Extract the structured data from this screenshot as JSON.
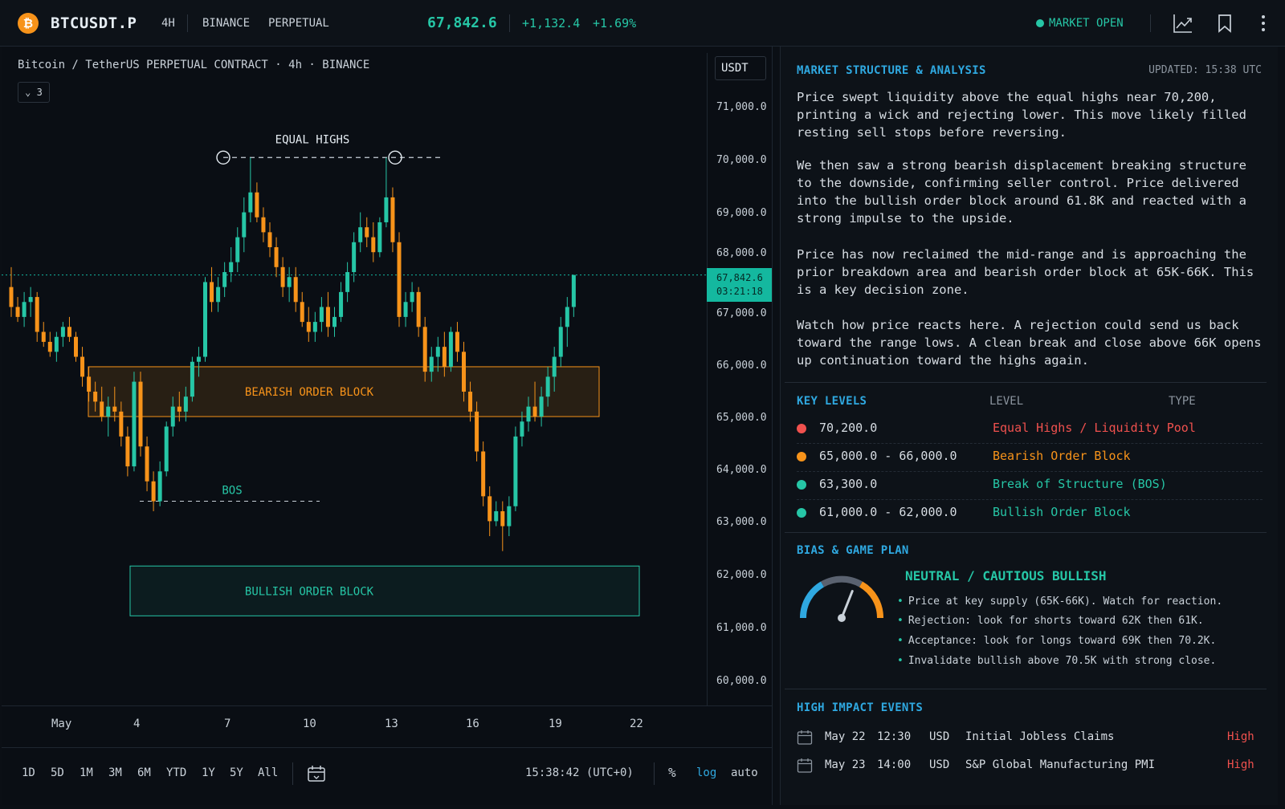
{
  "header": {
    "logo_glyph": "₿",
    "symbol": "BTCUSDT.P",
    "timeframe": "4H",
    "exchange": "BINANCE",
    "contract": "PERPETUAL",
    "price": "67,842.6",
    "change": "+1,132.4",
    "change_pct": "+1.69%",
    "market_status": "MARKET OPEN",
    "icons": [
      "chart-icon",
      "bookmark-icon",
      "more-icon"
    ]
  },
  "chart": {
    "title": "Bitcoin / TetherUS PERPETUAL CONTRACT · 4h · BINANCE",
    "indicator_toggle": "⌄ 3",
    "unit": "USDT",
    "y_ticks": [
      "71,000.0",
      "70,000.0",
      "69,000.0",
      "68,000.0",
      "67,000.0",
      "66,000.0",
      "65,000.0",
      "64,000.0",
      "63,000.0",
      "62,000.0",
      "61,000.0",
      "60,000.0"
    ],
    "price_tag": "67,842.6",
    "countdown": "03:21:18",
    "x_ticks": [
      "May",
      "4",
      "7",
      "10",
      "13",
      "16",
      "19",
      "22"
    ],
    "annotations": {
      "equal_highs": "EQUAL HIGHS",
      "bearish_ob": "BEARISH ORDER BLOCK",
      "bullish_ob": "BULLISH ORDER BLOCK",
      "bos": "BOS"
    },
    "ranges": [
      "1D",
      "5D",
      "1M",
      "3M",
      "6M",
      "YTD",
      "1Y",
      "5Y",
      "All"
    ],
    "clock": "15:38:42 (UTC+0)",
    "pct": "%",
    "log": "log",
    "auto": "auto",
    "colors": {
      "up": "#26c6a6",
      "down": "#f7931a",
      "bear_zone": "#f7931a",
      "bull_zone": "#26c6a6"
    }
  },
  "chart_data": {
    "type": "candlestick",
    "title": "Bitcoin / TetherUS PERPETUAL CONTRACT · 4h · BINANCE",
    "ylabel": "USDT",
    "ylim": [
      59700,
      71300
    ],
    "x_ticks": [
      "May",
      "4",
      "7",
      "10",
      "13",
      "16",
      "19",
      "22"
    ],
    "last_price": 67842.6,
    "levels": {
      "equal_highs": 70200,
      "bearish_order_block": [
        65000,
        66000
      ],
      "bos": 63300,
      "bullish_order_block": [
        61000,
        62000
      ]
    },
    "ohlc": [
      [
        67600,
        68000,
        67000,
        67200
      ],
      [
        67200,
        67400,
        66900,
        67000
      ],
      [
        67000,
        67500,
        66800,
        67300
      ],
      [
        67300,
        67600,
        67000,
        67400
      ],
      [
        67400,
        67500,
        66500,
        66700
      ],
      [
        66700,
        66900,
        66400,
        66500
      ],
      [
        66500,
        66700,
        66200,
        66300
      ],
      [
        66300,
        66700,
        66100,
        66600
      ],
      [
        66600,
        66900,
        66400,
        66800
      ],
      [
        66800,
        67000,
        66500,
        66600
      ],
      [
        66600,
        66700,
        66100,
        66200
      ],
      [
        66200,
        66400,
        65600,
        65800
      ],
      [
        65800,
        66000,
        65300,
        65500
      ],
      [
        65500,
        65700,
        65100,
        65300
      ],
      [
        65300,
        65600,
        64900,
        65000
      ],
      [
        65000,
        65400,
        64600,
        65200
      ],
      [
        65200,
        65600,
        64900,
        65100
      ],
      [
        65100,
        65300,
        64400,
        64600
      ],
      [
        64600,
        64800,
        63800,
        64000
      ],
      [
        64000,
        65900,
        63900,
        65700
      ],
      [
        65700,
        65900,
        64200,
        64400
      ],
      [
        64400,
        64600,
        63500,
        63700
      ],
      [
        63700,
        63900,
        63100,
        63300
      ],
      [
        63300,
        64100,
        63200,
        63900
      ],
      [
        63900,
        64900,
        63800,
        64800
      ],
      [
        64800,
        65400,
        64600,
        65200
      ],
      [
        65200,
        65500,
        64900,
        65100
      ],
      [
        65100,
        65600,
        64900,
        65400
      ],
      [
        65400,
        66200,
        65300,
        66100
      ],
      [
        66100,
        66400,
        65800,
        66200
      ],
      [
        66200,
        67800,
        66100,
        67700
      ],
      [
        67700,
        68000,
        67100,
        67300
      ],
      [
        67300,
        67800,
        67100,
        67600
      ],
      [
        67600,
        68100,
        67400,
        67900
      ],
      [
        67900,
        68400,
        67700,
        68100
      ],
      [
        68100,
        68800,
        67900,
        68600
      ],
      [
        68600,
        69400,
        68300,
        69100
      ],
      [
        69100,
        70200,
        68900,
        69500
      ],
      [
        69500,
        69700,
        68900,
        69000
      ],
      [
        69000,
        69200,
        68500,
        68700
      ],
      [
        68700,
        68900,
        68200,
        68400
      ],
      [
        68400,
        68600,
        67800,
        68000
      ],
      [
        68000,
        68200,
        67400,
        67600
      ],
      [
        67600,
        68000,
        67300,
        67800
      ],
      [
        67800,
        68000,
        67100,
        67300
      ],
      [
        67300,
        67500,
        66800,
        66900
      ],
      [
        66900,
        67200,
        66500,
        66700
      ],
      [
        66700,
        67100,
        66500,
        66900
      ],
      [
        66900,
        67400,
        66700,
        67200
      ],
      [
        67200,
        67500,
        66600,
        66800
      ],
      [
        66800,
        67200,
        66600,
        67000
      ],
      [
        67000,
        67700,
        66900,
        67500
      ],
      [
        67500,
        68100,
        67300,
        67900
      ],
      [
        67900,
        68700,
        67700,
        68500
      ],
      [
        68500,
        69100,
        68300,
        68800
      ],
      [
        68800,
        69000,
        68400,
        68600
      ],
      [
        68600,
        68900,
        68100,
        68300
      ],
      [
        68300,
        69000,
        68200,
        68900
      ],
      [
        68900,
        70200,
        68800,
        69400
      ],
      [
        69400,
        69600,
        68300,
        68500
      ],
      [
        68500,
        68700,
        66800,
        67000
      ],
      [
        67000,
        67500,
        66800,
        67300
      ],
      [
        67300,
        67700,
        67100,
        67500
      ],
      [
        67500,
        67600,
        66600,
        66800
      ],
      [
        66800,
        67000,
        65700,
        65900
      ],
      [
        65900,
        66400,
        65700,
        66200
      ],
      [
        66200,
        66600,
        65900,
        66400
      ],
      [
        66400,
        66700,
        65800,
        66000
      ],
      [
        66000,
        66800,
        65900,
        66700
      ],
      [
        66700,
        66900,
        66100,
        66300
      ],
      [
        66300,
        66500,
        65300,
        65500
      ],
      [
        65500,
        65700,
        64900,
        65100
      ],
      [
        65100,
        65300,
        64100,
        64300
      ],
      [
        64300,
        64500,
        63200,
        63400
      ],
      [
        63400,
        63600,
        62600,
        62900
      ],
      [
        62900,
        63300,
        62800,
        63100
      ],
      [
        63100,
        63300,
        62300,
        62800
      ],
      [
        62800,
        63400,
        62600,
        63200
      ],
      [
        63200,
        64800,
        63100,
        64600
      ],
      [
        64600,
        65100,
        64400,
        64900
      ],
      [
        64900,
        65400,
        64700,
        65200
      ],
      [
        65200,
        65700,
        64900,
        65000
      ],
      [
        65000,
        65600,
        64800,
        65400
      ],
      [
        65400,
        66000,
        65200,
        65800
      ],
      [
        65800,
        66400,
        65500,
        66200
      ],
      [
        66200,
        67000,
        66000,
        66800
      ],
      [
        66800,
        67400,
        66400,
        67200
      ],
      [
        67200,
        67842.6,
        67000,
        67842.6
      ]
    ]
  },
  "panel": {
    "analysis": {
      "heading": "MARKET STRUCTURE & ANALYSIS",
      "updated": "UPDATED: 15:38 UTC",
      "p1": "Price swept liquidity above the equal highs near 70,200, printing a wick and rejecting lower. This move likely filled resting sell stops before reversing.",
      "p2": "We then saw a strong bearish displacement breaking structure to the downside, confirming seller control. Price delivered into the bullish order block around 61.8K and reacted with a strong impulse to the upside.",
      "p3": "Price has now reclaimed the mid-range and is approaching the prior breakdown area and bearish order block at 65K-66K. This is a key decision zone.",
      "p4": "Watch how price reacts here. A rejection could send us back toward the range lows. A clean break and close above 66K opens up continuation toward the highs again."
    },
    "key_levels": {
      "heading": "KEY LEVELS",
      "col_level": "LEVEL",
      "col_type": "TYPE",
      "rows": [
        {
          "level": "70,200.0",
          "type": "Equal Highs / Liquidity Pool",
          "color": "#f0514e"
        },
        {
          "level": "65,000.0 - 66,000.0",
          "type": "Bearish Order Block",
          "color": "#f7931a"
        },
        {
          "level": "63,300.0",
          "type": "Break of Structure (BOS)",
          "color": "#26c6a6"
        },
        {
          "level": "61,000.0 - 62,000.0",
          "type": "Bullish Order Block",
          "color": "#26c6a6"
        }
      ]
    },
    "bias": {
      "heading": "BIAS & GAME PLAN",
      "title": "NEUTRAL / CAUTIOUS BULLISH",
      "gauge_level": 0.62,
      "bullets": [
        "Price at key supply (65K-66K). Watch for reaction.",
        "Rejection: look for shorts toward 62K then 61K.",
        "Acceptance: look for longs toward 69K then 70.2K.",
        "Invalidate bullish above 70.5K with strong close."
      ]
    },
    "events": {
      "heading": "HIGH IMPACT EVENTS",
      "rows": [
        {
          "date": "May 22",
          "time": "12:30",
          "ccy": "USD",
          "name": "Initial Jobless Claims",
          "impact": "High"
        },
        {
          "date": "May 23",
          "time": "14:00",
          "ccy": "USD",
          "name": "S&P Global Manufacturing PMI",
          "impact": "High"
        }
      ]
    }
  }
}
